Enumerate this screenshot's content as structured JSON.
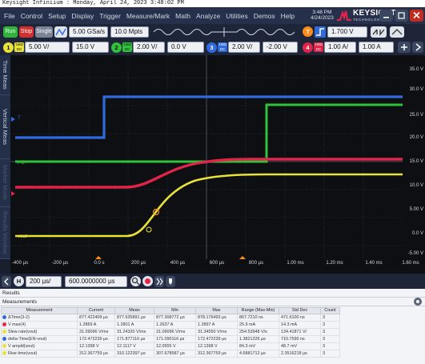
{
  "window": {
    "title": "Keysight Infiniium : Monday, April 24, 2023 3:48:02 PM"
  },
  "menubar": {
    "items": [
      "File",
      "Control",
      "Setup",
      "Display",
      "Trigger",
      "Measure/Mark",
      "Math",
      "Analyze",
      "Utilities",
      "Demos",
      "Help"
    ],
    "clock_time": "3:48 PM",
    "clock_date": "4/24/2023",
    "brand": "KEYSIGHT",
    "brand_sub": "TECHNOLOGIES"
  },
  "acquisition": {
    "run_label": "Run",
    "stop_label": "Stop",
    "single_label": "Single",
    "sample_rate": "5.00 GSa/s",
    "memory_depth": "10.0 Mpts",
    "trigger_source": "T",
    "trigger_level": "1.700 V",
    "trigger_slope_icon": "rising-edge-icon"
  },
  "channels": [
    {
      "id": "1",
      "coupling": "1MΩ DC",
      "scale": "5.00 V/",
      "offset": "15.0 V",
      "color": "#e8e23a"
    },
    {
      "id": "2",
      "coupling": "1MΩ DC",
      "scale": "2.00 V/",
      "offset": "0.0 V",
      "color": "#30c23a"
    },
    {
      "id": "3",
      "coupling": "1MΩ DC",
      "scale": "2.00 V/",
      "offset": "-2.00 V",
      "color": "#2f6bde"
    },
    {
      "id": "4",
      "coupling": "1MΩ DC",
      "scale": "1.00 A/",
      "offset": "1.00 A",
      "color": "#e0244a"
    }
  ],
  "side_tabs": [
    "Time Meas",
    "Vertical Meas",
    "Marker Mode",
    "Results Window"
  ],
  "trace_labels": {
    "ch2": "PG",
    "ch1": "vout",
    "ch3": "T"
  },
  "y_axis_labels": [
    "35.0 V",
    "30.0 V",
    "25.0 V",
    "20.0 V",
    "15.0 V",
    "10.0 V",
    "5.00 V",
    "0.0 V",
    "-5.00 V"
  ],
  "x_axis_labels": [
    "-400 µs",
    "-200 µs",
    "0.0 s",
    "200 µs",
    "400 µs",
    "600 µs",
    "800 µs",
    "1.00 ms",
    "1.20 ms",
    "1.40 ms",
    "1.60 ms"
  ],
  "timebase": {
    "channel_label": "H",
    "scale": "200 µs/",
    "position": "600.0000000 µs",
    "zoom_icon": "zoom-icon",
    "record_icon": "record-icon"
  },
  "results": {
    "title": "Results",
    "section": "Measurements",
    "columns": [
      "Measurement",
      "Current",
      "Mean",
      "Min",
      "Max",
      "Range (Max-Min)",
      "Std Dev",
      "Count"
    ],
    "rows": [
      {
        "color": "#2f6bde",
        "cells": [
          "ΔTime(3-2)",
          "877.422409 µs",
          "877.635891 µs",
          "877.308772 µs",
          "878.176493 µs",
          "867.7210 ns",
          "471.6100 ns",
          "3"
        ]
      },
      {
        "color": "#e0244a",
        "cells": [
          "V max(4)",
          "1.2869 A",
          "1.2801 A",
          "1.2637 A",
          "1.2897 A",
          "25.9 mA",
          "14.3 mA",
          "3"
        ]
      },
      {
        "color": "#e8e23a",
        "cells": [
          "Slew rate(vout)",
          "31.09096 V/ms",
          "31.24320 V/ms",
          "31.09096 V/ms",
          "31.34550 V/ms",
          "254.53948 V/s",
          "134.41871 V/",
          "3"
        ]
      },
      {
        "color": "#2f6bde",
        "cells": [
          "delta-Time(EN-vout)",
          "172.472239 µs",
          "171.877116 µs",
          "171.090116 µs",
          "172.472239 µs",
          "1.3821226 µs",
          "710.7590 ns",
          "3"
        ]
      },
      {
        "color": "#e8e23a",
        "cells": [
          "V ampld(vout)",
          "12.1398 V",
          "12.1117 V",
          "12.0555 V",
          "12.1398 V",
          "84.3 mV",
          "48.7 mV",
          "3"
        ]
      },
      {
        "color": "#e8e23a",
        "cells": [
          "Rise time(vout)",
          "312.367759 µs",
          "310.122397 µs",
          "307.678587 µs",
          "312.367759 µs",
          "4.6881712 µs",
          "2.3516218 µs",
          "3"
        ]
      }
    ]
  }
}
